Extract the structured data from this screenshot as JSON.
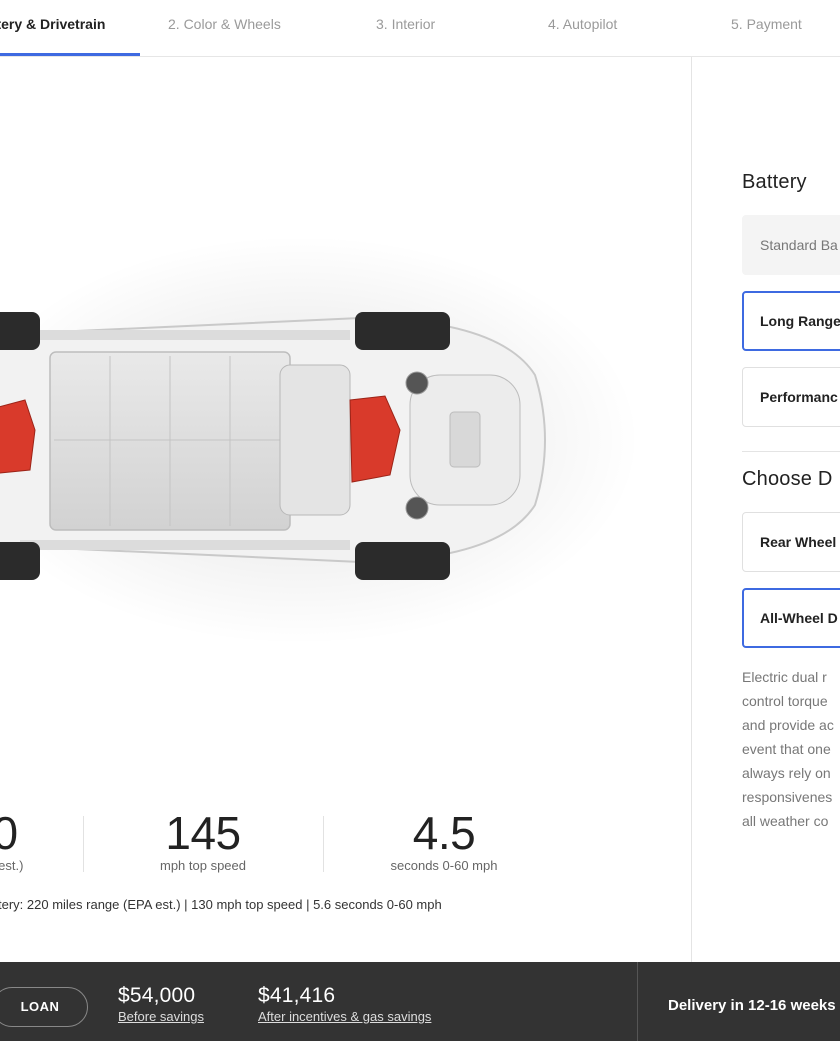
{
  "steps": [
    {
      "label": "attery & Drivetrain"
    },
    {
      "label": "2. Color & Wheels"
    },
    {
      "label": "3. Interior"
    },
    {
      "label": "4. Autopilot"
    },
    {
      "label": "5. Payment"
    }
  ],
  "specs": [
    {
      "value": "0",
      "label": "A est.)"
    },
    {
      "value": "145",
      "label": "mph top speed"
    },
    {
      "value": "4.5",
      "label": "seconds 0-60 mph"
    }
  ],
  "spec_footnote": "tery: 220 miles range (EPA est.) | 130 mph top speed | 5.6 seconds 0-60 mph",
  "battery": {
    "title": "Battery",
    "options": [
      "Standard Ba",
      "Long Range",
      "Performanc"
    ]
  },
  "drive": {
    "title": "Choose D",
    "options": [
      "Rear Wheel",
      "All-Wheel D"
    ],
    "description": "Electric dual r\ncontrol torque\nand provide ac\nevent that one\nalways rely on\nresponsivenes\nall weather co"
  },
  "bottom": {
    "loan_label": "LOAN",
    "price_before": "$54,000",
    "price_before_label": "Before savings",
    "price_after": "$41,416",
    "price_after_label": "After incentives & gas savings",
    "delivery": "Delivery in 12-16 weeks"
  },
  "colors": {
    "accent": "#3e6ae1",
    "bar": "#333333",
    "motor": "#d93a2b"
  }
}
